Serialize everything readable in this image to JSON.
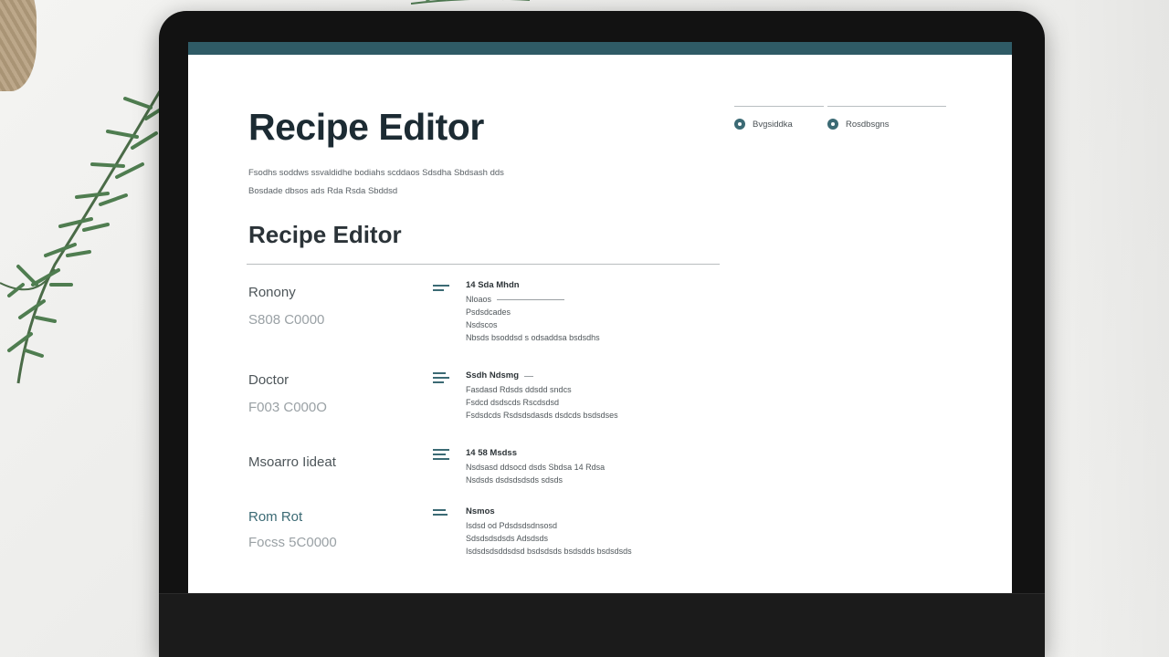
{
  "page": {
    "title": "Recipe Editor",
    "intro_lines": [
      "Fsodhs soddws ssvaldidhe bodiahs scddaos Sdsdha Sbdsash dds",
      "Bosdade dbsos ads Rda Rsda Sbddsd"
    ]
  },
  "header_nav": {
    "links": [
      {
        "label": "Bvgsiddka",
        "icon": "circle-icon"
      },
      {
        "label": "Rosdbsgns",
        "icon": "circle-icon"
      }
    ]
  },
  "section": {
    "title": "Recipe Editor"
  },
  "recipes": [
    {
      "name": "Ronony",
      "value": "S808 C0000",
      "icon": "list-icon",
      "detail_head": "14 Sda Mhdn",
      "detail_lines": [
        "Nloaos",
        "Psdsdcades",
        "Nsdscos",
        "Nbsds bsoddsd s odsaddsa bsdsdhs"
      ]
    },
    {
      "name": "Doctor",
      "value": "F003 C000O",
      "icon": "list-icon",
      "detail_head": "Ssdh Ndsmg",
      "detail_lines": [
        "Fasdasd Rdsds ddsdd sndcs",
        "Fsdcd dsdscds Rscdsdsd",
        "Fsdsdcds Rsdsdsdasds dsdcds bsdsdses"
      ]
    },
    {
      "name": "Msoarro Iideat",
      "value": "",
      "icon": "list-icon",
      "detail_head": "14 58 Msdss",
      "detail_lines": [
        "Nsdsasd ddsocd dsds Sbdsa 14 Rdsa",
        "Nsdsds dsdsdsdsds sdsds"
      ]
    },
    {
      "name": "Rom Rot",
      "value": "Focss 5C0000",
      "icon": "list-icon",
      "detail_head": "Nsmos",
      "detail_lines": [
        "Isdsd od Pdsdsdsdnsosd",
        "Sdsdsdsdsds Adsdsds",
        "Isdsdsdsddsdsd bsdsdsds bsdsdds bsdsdsds"
      ]
    }
  ],
  "colors": {
    "accent": "#3b6a74",
    "topbar": "#2f5b66",
    "title": "#1c2b33"
  }
}
